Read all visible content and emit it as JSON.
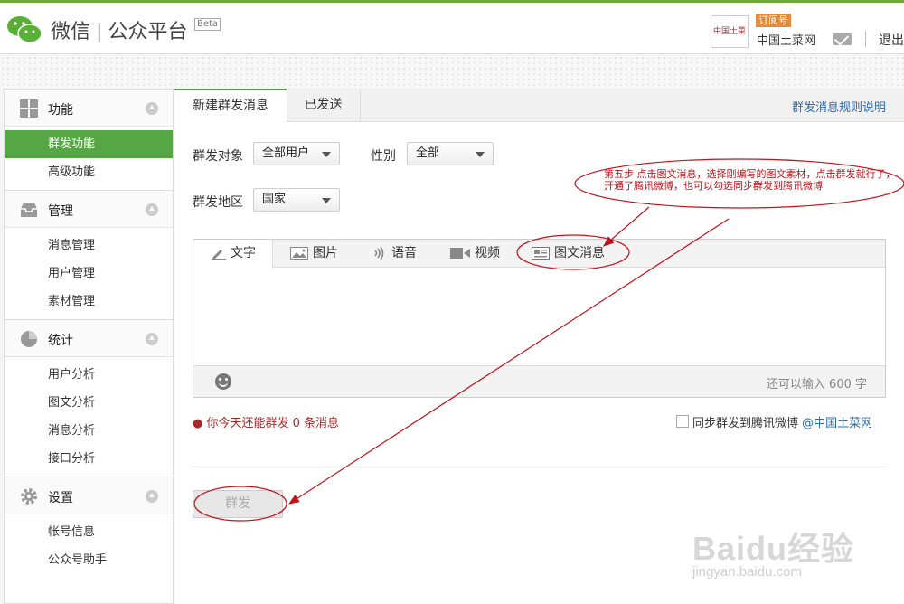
{
  "header": {
    "product": "微信",
    "platform": "公众平台",
    "beta": "Beta",
    "account_logo_text": "中国土菜网",
    "account_badge": "订阅号",
    "account_name": "中国土菜网",
    "logout": "退出"
  },
  "sidebar": {
    "sections": [
      {
        "title": "功能",
        "icon": "grid-icon",
        "items": [
          {
            "label": "群发功能",
            "active": true
          },
          {
            "label": "高级功能",
            "active": false
          }
        ]
      },
      {
        "title": "管理",
        "icon": "inbox-icon",
        "items": [
          {
            "label": "消息管理"
          },
          {
            "label": "用户管理"
          },
          {
            "label": "素材管理"
          }
        ]
      },
      {
        "title": "统计",
        "icon": "pie-chart-icon",
        "items": [
          {
            "label": "用户分析"
          },
          {
            "label": "图文分析"
          },
          {
            "label": "消息分析"
          },
          {
            "label": "接口分析"
          }
        ]
      },
      {
        "title": "设置",
        "icon": "gear-icon",
        "items": [
          {
            "label": "帐号信息"
          },
          {
            "label": "公众号助手"
          }
        ]
      }
    ]
  },
  "tabs": {
    "new": "新建群发消息",
    "sent": "已发送",
    "rules_link": "群发消息规则说明"
  },
  "form": {
    "target_label": "群发对象",
    "target_value": "全部用户",
    "gender_label": "性别",
    "gender_value": "全部",
    "region_label": "群发地区",
    "region_value": "国家"
  },
  "editor": {
    "tabs": [
      {
        "label": "文字",
        "icon": "pencil-icon"
      },
      {
        "label": "图片",
        "icon": "image-icon"
      },
      {
        "label": "语音",
        "icon": "sound-icon"
      },
      {
        "label": "视频",
        "icon": "video-icon"
      },
      {
        "label": "图文消息",
        "icon": "news-icon"
      }
    ],
    "remaining": "还可以输入 600 字"
  },
  "limit_notice": "● 你今天还能群发 0 条消息",
  "sync": {
    "label": "同步群发到腾讯微博",
    "handle": "@中国土菜网"
  },
  "send_button": "群发",
  "annotation": {
    "text": "第五步 点击图文消息，选择刚编写的图文素材，点击群发就行了，开通了腾讯微博，也可以勾选同步群发到腾讯微博",
    "color": "#c2121b"
  },
  "watermark": {
    "main": "Baidu经验",
    "sub": "jingyan.baidu.com"
  },
  "colors": {
    "accent_green": "#56a645",
    "link_blue": "#2b6cb0",
    "annotation_red": "#c2121b"
  }
}
